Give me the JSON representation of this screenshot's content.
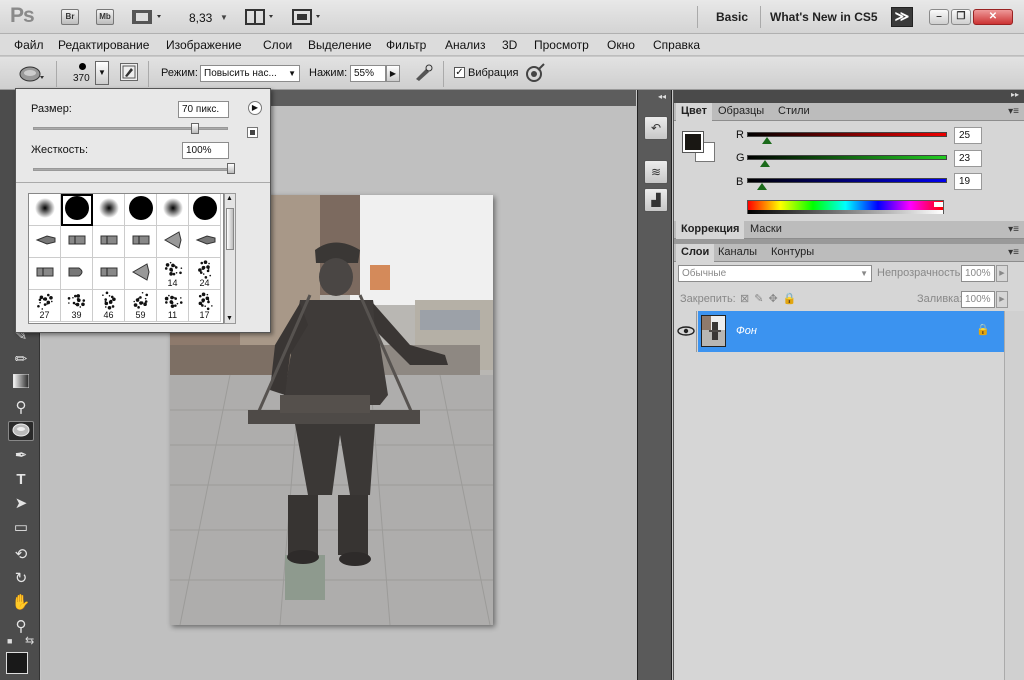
{
  "titlebar": {
    "app_logo": "Ps",
    "bridge": "Br",
    "minibridge": "Mb",
    "zoom": "8,33",
    "workspace_basic": "Basic",
    "workspace_whatsnew": "What's New in CS5",
    "more": "≫",
    "min": "–",
    "restore": "❐",
    "close": "✕"
  },
  "menu": [
    "Файл",
    "Редактирование",
    "Изображение",
    "Слои",
    "Выделение",
    "Фильтр",
    "Анализ",
    "3D",
    "Просмотр",
    "Окно",
    "Справка"
  ],
  "options": {
    "brush_size": "370",
    "mode_label": "Режим:",
    "mode_value": "Повысить нас...",
    "pressure_label": "Нажим:",
    "pressure_value": "55%",
    "vibrance_label": "Вибрация",
    "vibrance_checked": true
  },
  "brush_popup": {
    "size_label": "Размер:",
    "size_value": "70 пикс.",
    "size_fraction": 0.83,
    "hardness_label": "Жесткость:",
    "hardness_value": "100%",
    "hardness_fraction": 1.0,
    "presets": [
      {
        "kind": "soft",
        "n": ""
      },
      {
        "kind": "hard",
        "n": ""
      },
      {
        "kind": "soft",
        "n": ""
      },
      {
        "kind": "hard",
        "n": ""
      },
      {
        "kind": "soft",
        "n": ""
      },
      {
        "kind": "hard",
        "n": ""
      },
      {
        "kind": "bristle",
        "n": ""
      },
      {
        "kind": "flat",
        "n": ""
      },
      {
        "kind": "flat",
        "n": ""
      },
      {
        "kind": "flat",
        "n": ""
      },
      {
        "kind": "fan",
        "n": ""
      },
      {
        "kind": "bristle",
        "n": ""
      },
      {
        "kind": "flat",
        "n": ""
      },
      {
        "kind": "round",
        "n": ""
      },
      {
        "kind": "flat",
        "n": ""
      },
      {
        "kind": "fan",
        "n": ""
      },
      {
        "kind": "spray",
        "n": "14"
      },
      {
        "kind": "spray",
        "n": "24"
      },
      {
        "kind": "spray",
        "n": "27"
      },
      {
        "kind": "spray",
        "n": "39"
      },
      {
        "kind": "spray",
        "n": "46"
      },
      {
        "kind": "spray",
        "n": "59"
      },
      {
        "kind": "spray",
        "n": "11"
      },
      {
        "kind": "spray",
        "n": "17"
      }
    ]
  },
  "color_panel": {
    "tabs": [
      "Цвет",
      "Образцы",
      "Стили"
    ],
    "r_label": "R",
    "r_value": "25",
    "r": 25,
    "g_label": "G",
    "g_value": "23",
    "g": 23,
    "b_label": "B",
    "b_value": "19",
    "b": 19,
    "fg_color": "#191713"
  },
  "correction_panel": {
    "tabs": [
      "Коррекция",
      "Маски"
    ]
  },
  "layers_panel": {
    "tabs": [
      "Слои",
      "Каналы",
      "Контуры"
    ],
    "blend_mode": "Обычные",
    "opacity_label": "Непрозрачность:",
    "opacity_value": "100%",
    "lock_label": "Закрепить:",
    "fill_label": "Заливка:",
    "fill_value": "100%",
    "layer_name": "Фон",
    "selected_color": "#3b93f0"
  }
}
